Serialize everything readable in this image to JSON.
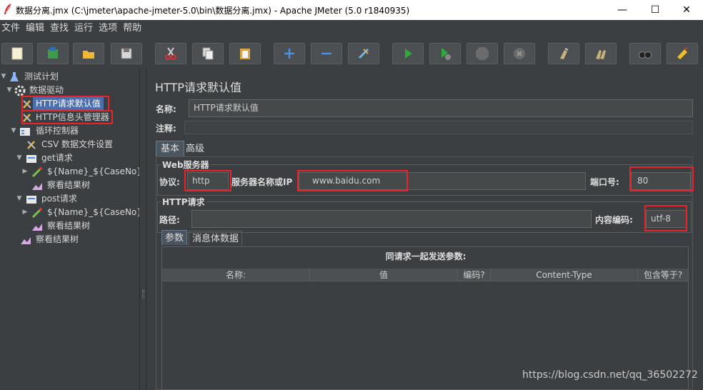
{
  "window": {
    "title": "数据分离.jmx (C:\\jmeter\\apache-jmeter-5.0\\bin\\数据分离.jmx) - Apache JMeter (5.0 r1840935)",
    "minimize": "—",
    "maximize": "☐",
    "close": "✕"
  },
  "menu": [
    "文件",
    "编辑",
    "查找",
    "运行",
    "选项",
    "帮助"
  ],
  "toolbar": [
    "new-icon",
    "templates-icon",
    "open-icon",
    "save-icon",
    "cut-icon",
    "copy-icon",
    "paste-icon",
    "expand-icon",
    "collapse-icon",
    "toggle-icon",
    "start-icon",
    "start-no-pause-icon",
    "stop-icon",
    "shutdown-icon",
    "clear-icon",
    "clear-all-icon",
    "search-icon",
    "reset-search-icon"
  ],
  "tree": [
    {
      "label": "测试计划",
      "icon": "test-plan-icon"
    },
    {
      "label": "数据驱动",
      "icon": "thread-group-icon"
    },
    {
      "label": "HTTP请求默认值",
      "icon": "config-element-icon"
    },
    {
      "label": "HTTP信息头管理器",
      "icon": "config-element-icon"
    },
    {
      "label": "循环控制器",
      "icon": "loop-controller-icon"
    },
    {
      "label": "CSV 数据文件设置",
      "icon": "config-element-icon"
    },
    {
      "label": "get请求",
      "icon": "sampler-icon"
    },
    {
      "label": "${Name}_${CaseNo}",
      "icon": "assertion-icon"
    },
    {
      "label": "察看结果树",
      "icon": "listener-icon"
    },
    {
      "label": "post请求",
      "icon": "sampler-icon"
    },
    {
      "label": "${Name}_${CaseNo}",
      "icon": "assertion-icon"
    },
    {
      "label": "察看结果树",
      "icon": "listener-icon"
    },
    {
      "label": "察看结果树",
      "icon": "listener-icon"
    }
  ],
  "panel": {
    "title": "HTTP请求默认值",
    "name_label": "名称:",
    "name_value": "HTTP请求默认值",
    "comment_label": "注释:",
    "comment_value": "",
    "tabs": [
      "基本",
      "高级"
    ],
    "web_server": {
      "group_title": "Web服务器",
      "protocol_label": "协议:",
      "protocol_value": "http",
      "server_label": "服务器名称或IP",
      "server_value": "www.baidu.com",
      "port_label": "端口号:",
      "port_value": "80"
    },
    "http_request": {
      "group_title": "HTTP请求",
      "path_label": "路径:",
      "path_value": "",
      "encoding_label": "内容编码:",
      "encoding_value": "utf-8"
    },
    "sub_tabs": [
      "参数",
      "消息体数据"
    ],
    "params_title": "同请求一起发送参数:",
    "columns": [
      "名称:",
      "值",
      "编码?",
      "Content-Type",
      "包含等于?"
    ]
  },
  "watermark": "https://blog.csdn.net/qq_36502272",
  "colors": {
    "highlight": "#e8232a",
    "selection": "#4b6eaf",
    "background": "#3c3f41"
  }
}
